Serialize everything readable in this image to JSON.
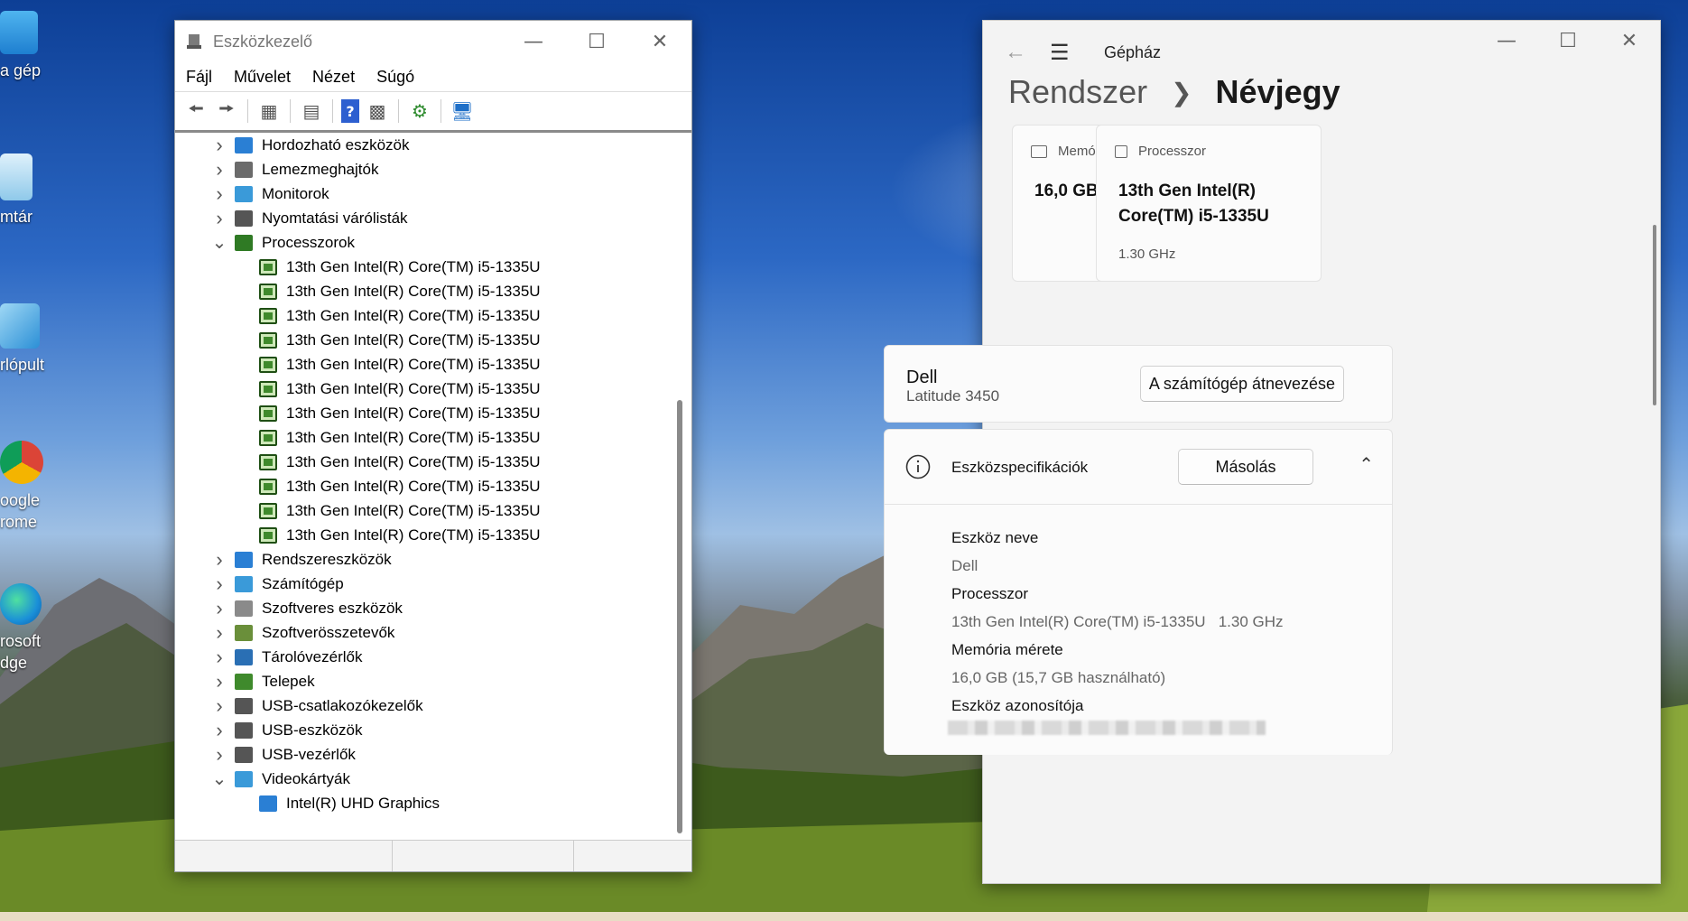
{
  "desktop": {
    "icons": [
      {
        "label": "a gép"
      },
      {
        "label": "mtár"
      },
      {
        "label": "rlópult"
      },
      {
        "label": "oogle\nrome"
      },
      {
        "label": "rosoft\ndge"
      }
    ]
  },
  "device_manager": {
    "title": "Eszközkezelő",
    "menu": [
      "Fájl",
      "Művelet",
      "Nézet",
      "Súgó"
    ],
    "tree": [
      {
        "label": "Hordozható eszközök",
        "expanded": false
      },
      {
        "label": "Lemezmeghajtók",
        "expanded": false
      },
      {
        "label": "Monitorok",
        "expanded": false
      },
      {
        "label": "Nyomtatási várólisták",
        "expanded": false
      },
      {
        "label": "Processzorok",
        "expanded": true
      },
      {
        "label": "13th Gen Intel(R) Core(TM) i5-1335U",
        "child": true
      },
      {
        "label": "13th Gen Intel(R) Core(TM) i5-1335U",
        "child": true
      },
      {
        "label": "13th Gen Intel(R) Core(TM) i5-1335U",
        "child": true
      },
      {
        "label": "13th Gen Intel(R) Core(TM) i5-1335U",
        "child": true
      },
      {
        "label": "13th Gen Intel(R) Core(TM) i5-1335U",
        "child": true
      },
      {
        "label": "13th Gen Intel(R) Core(TM) i5-1335U",
        "child": true
      },
      {
        "label": "13th Gen Intel(R) Core(TM) i5-1335U",
        "child": true
      },
      {
        "label": "13th Gen Intel(R) Core(TM) i5-1335U",
        "child": true
      },
      {
        "label": "13th Gen Intel(R) Core(TM) i5-1335U",
        "child": true
      },
      {
        "label": "13th Gen Intel(R) Core(TM) i5-1335U",
        "child": true
      },
      {
        "label": "13th Gen Intel(R) Core(TM) i5-1335U",
        "child": true
      },
      {
        "label": "13th Gen Intel(R) Core(TM) i5-1335U",
        "child": true
      },
      {
        "label": "Rendszereszközök",
        "expanded": false
      },
      {
        "label": "Számítógép",
        "expanded": false
      },
      {
        "label": "Szoftveres eszközök",
        "expanded": false
      },
      {
        "label": "Szoftverösszetevők",
        "expanded": false
      },
      {
        "label": "Tárolóvezérlők",
        "expanded": false
      },
      {
        "label": "Telepek",
        "expanded": false
      },
      {
        "label": "USB-csatlakozókezelők",
        "expanded": false
      },
      {
        "label": "USB-eszközök",
        "expanded": false
      },
      {
        "label": "USB-vezérlők",
        "expanded": false
      },
      {
        "label": "Videokártyák",
        "expanded": true
      },
      {
        "label": "Intel(R) UHD Graphics",
        "child": true
      }
    ]
  },
  "settings": {
    "app_name": "Gépház",
    "breadcrumb": {
      "parent": "Rendszer",
      "current": "Névjegy"
    },
    "memory_card": {
      "heading": "Memória mérete",
      "value": "16,0 GB"
    },
    "processor_card": {
      "heading": "Processzor",
      "value_line1": "13th Gen Intel(R)",
      "value_line2": "Core(TM) i5-1335U",
      "speed": "1.30 GHz"
    },
    "device_card": {
      "maker": "Dell",
      "model": "Latitude 3450",
      "rename_button": "A számítógép átnevezése"
    },
    "specs": {
      "title": "Eszközspecifikációk",
      "copy_button": "Másolás",
      "device_name_label": "Eszköz neve",
      "device_name_value": "Dell",
      "processor_label": "Processzor",
      "processor_value": "13th Gen Intel(R) Core(TM) i5-1335U   1.30 GHz",
      "memory_label": "Memória mérete",
      "memory_value": "16,0 GB (15,7 GB használható)",
      "device_id_label": "Eszköz azonosítója"
    }
  }
}
